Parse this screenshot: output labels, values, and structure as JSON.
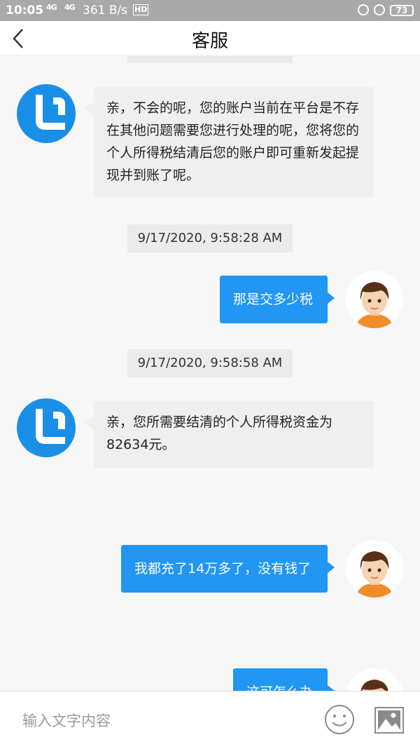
{
  "status_bar": {
    "time": "10:05",
    "signal_1": "4G",
    "signal_2": "4G",
    "net_speed": "361 B/s",
    "hd": "HD",
    "battery": "73"
  },
  "header": {
    "title": "客服"
  },
  "messages": [
    {
      "sender": "agent",
      "text": "亲，不会的呢，您的账户当前在平台是不存在其他问题需要您进行处理的呢，您将您的个人所得税结清后您的账户即可重新发起提现并到账了呢。"
    },
    {
      "timestamp": "9/17/2020, 9:58:28 AM"
    },
    {
      "sender": "user",
      "text": "那是交多少税"
    },
    {
      "timestamp": "9/17/2020, 9:58:58 AM"
    },
    {
      "sender": "agent",
      "text": "亲，您所需要结清的个人所得税资金为82634元。"
    },
    {
      "sender": "user",
      "text": "我都充了14万多了，没有钱了"
    },
    {
      "sender": "user",
      "text": "这可怎么办"
    }
  ],
  "input": {
    "placeholder": "输入文字内容",
    "value": ""
  },
  "colors": {
    "accent": "#2196f3",
    "status_bar": "#a9a9a9",
    "agent_bubble": "#efefef"
  },
  "icons": [
    "back-arrow-icon",
    "emoji-icon",
    "image-icon",
    "bot-logo-icon",
    "user-avatar-icon"
  ]
}
